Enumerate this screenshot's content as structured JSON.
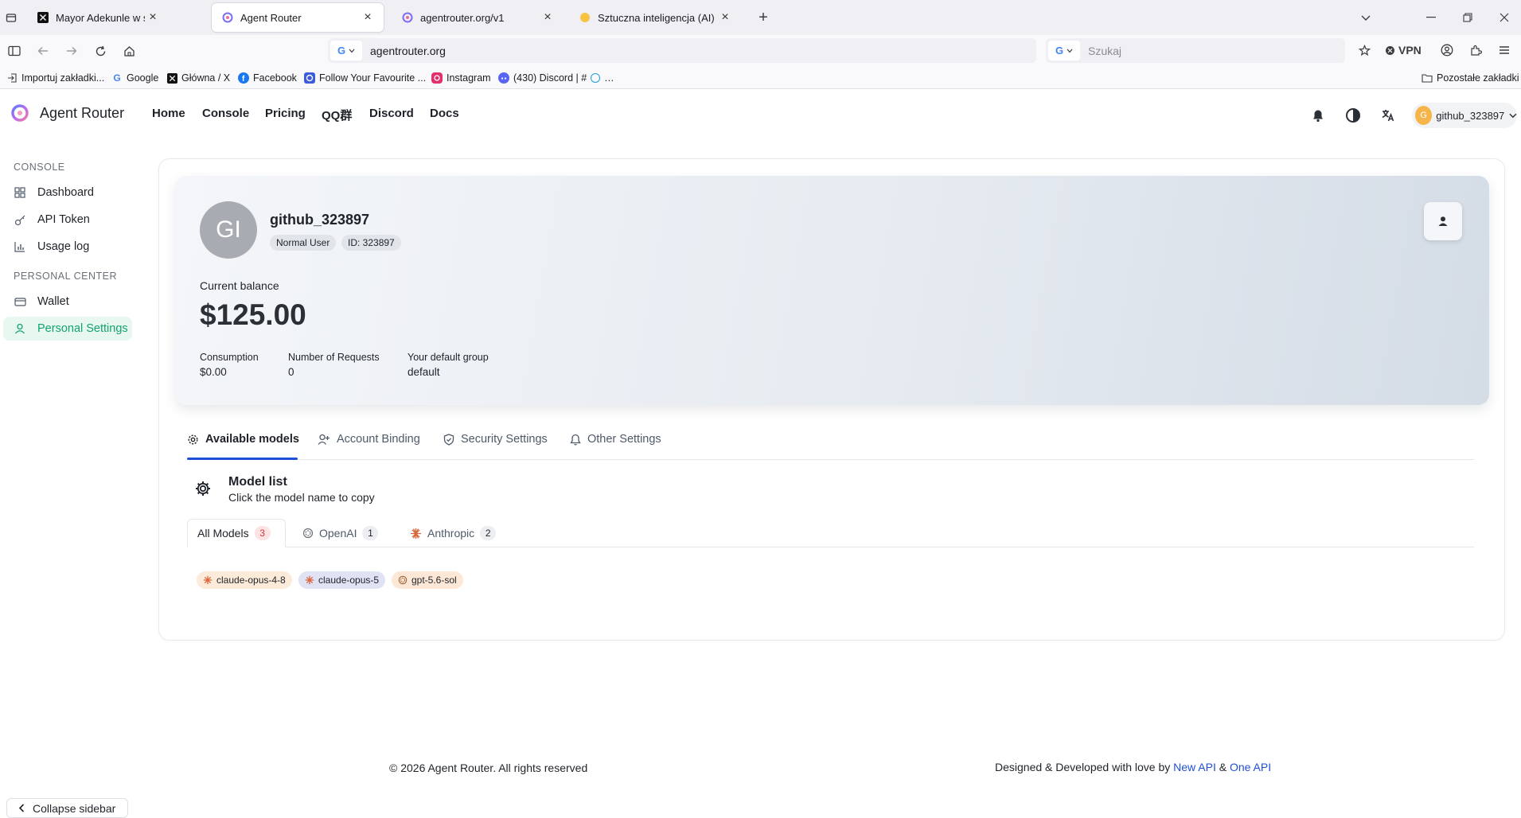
{
  "browser": {
    "tabs": [
      {
        "title": "Mayor Adekunle w serwisie X: „I"
      },
      {
        "title": "Agent Router"
      },
      {
        "title": "agentrouter.org/v1"
      },
      {
        "title": "Sztuczna inteligencja (AI) - co to"
      }
    ],
    "url": "agentrouter.org",
    "search_placeholder": "Szukaj",
    "vpn_label": "VPN",
    "bookmarks": [
      {
        "label": "Importuj zakładki..."
      },
      {
        "label": "Google"
      },
      {
        "label": "Główna / X"
      },
      {
        "label": "Facebook"
      },
      {
        "label": "Follow Your Favourite ..."
      },
      {
        "label": "Instagram"
      },
      {
        "label": "(430) Discord | #"
      }
    ],
    "other_bookmarks": "Pozostałe zakładki"
  },
  "header": {
    "brand": "Agent Router",
    "nav": [
      "Home",
      "Console",
      "Pricing",
      "QQ群",
      "Discord",
      "Docs"
    ],
    "user": {
      "avatar_letter": "G",
      "name": "github_323897"
    }
  },
  "sidebar": {
    "sections": [
      {
        "title": "CONSOLE",
        "items": [
          {
            "label": "Dashboard",
            "icon": "grid-icon"
          },
          {
            "label": "API Token",
            "icon": "key-icon"
          },
          {
            "label": "Usage log",
            "icon": "bar-chart-icon"
          }
        ]
      },
      {
        "title": "PERSONAL CENTER",
        "items": [
          {
            "label": "Wallet",
            "icon": "wallet-icon"
          },
          {
            "label": "Personal Settings",
            "icon": "user-icon",
            "active": true
          }
        ]
      }
    ],
    "collapse_label": "Collapse sidebar"
  },
  "profile": {
    "avatar_text": "GI",
    "username": "github_323897",
    "role_badge": "Normal User",
    "id_badge": "ID: 323897",
    "balance_label": "Current balance",
    "balance": "$125.00",
    "stats": [
      {
        "label": "Consumption",
        "value": "$0.00"
      },
      {
        "label": "Number of Requests",
        "value": "0"
      },
      {
        "label": "Your default group",
        "value": "default"
      }
    ]
  },
  "settings_tabs": [
    {
      "label": "Available models",
      "icon": "gear-icon",
      "active": true
    },
    {
      "label": "Account Binding",
      "icon": "user-plus-icon"
    },
    {
      "label": "Security Settings",
      "icon": "shield-icon"
    },
    {
      "label": "Other Settings",
      "icon": "bell-icon"
    }
  ],
  "model_list": {
    "title": "Model list",
    "subtitle": "Click the model name to copy",
    "filters": [
      {
        "label": "All Models",
        "count": "3",
        "active": true
      },
      {
        "label": "OpenAI",
        "count": "1",
        "icon": "openai-icon"
      },
      {
        "label": "Anthropic",
        "count": "2",
        "icon": "anthropic-icon"
      }
    ],
    "models": [
      {
        "name": "claude-opus-4-8",
        "provider": "anthropic",
        "color": "#fdebd9"
      },
      {
        "name": "claude-opus-5",
        "provider": "anthropic",
        "color": "#dfe3f3"
      },
      {
        "name": "gpt-5.6-sol",
        "provider": "openai",
        "color": "#fde7d6"
      }
    ]
  },
  "footer": {
    "copyright": "© 2026 Agent Router. All rights reserved",
    "credit_prefix": "Designed & Developed with love by",
    "link1": "New API",
    "amp": "&",
    "link2": "One API"
  },
  "colors": {
    "accent": "#11a56d",
    "link": "#1f4fd9",
    "active_tab_underline": "#1f4fd9"
  }
}
